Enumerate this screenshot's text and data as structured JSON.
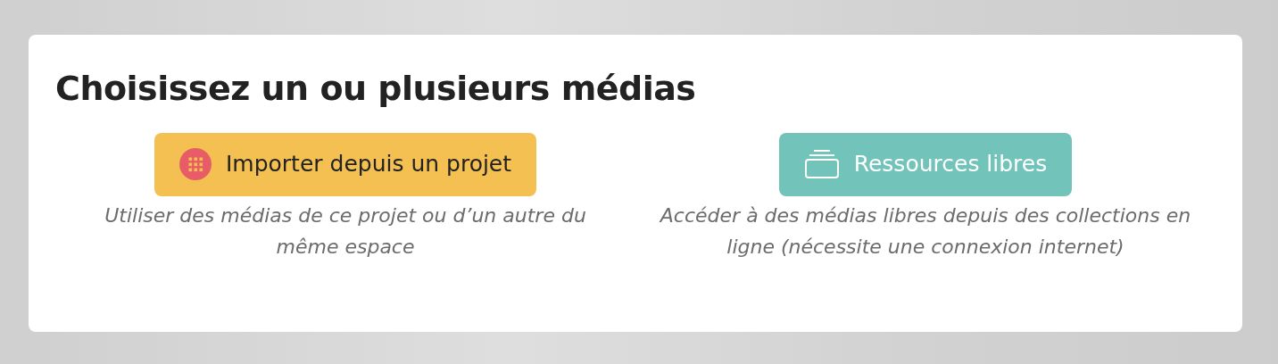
{
  "title": "Choisissez un ou plusieurs médias",
  "options": [
    {
      "kind": "project",
      "label": "Importer depuis un projet",
      "description": "Utiliser des médias de ce projet ou d’un autre du même espace"
    },
    {
      "kind": "free",
      "label": "Ressources libres",
      "description": "Accéder à des médias libres depuis des collections en ligne (nécessite une connexion internet)"
    }
  ]
}
